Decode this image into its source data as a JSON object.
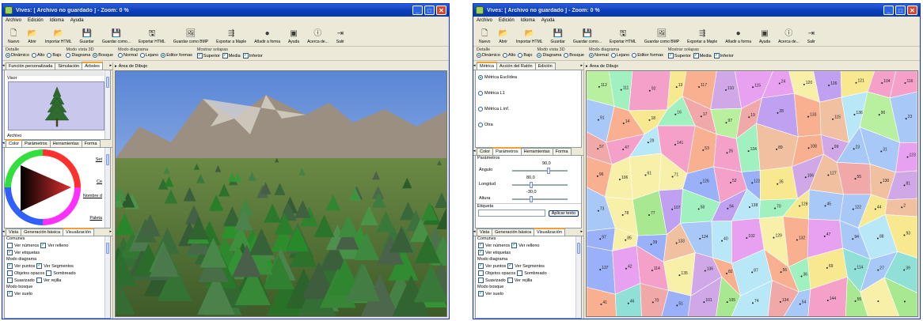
{
  "left": {
    "title": "Vives: [ Archivo no guardado ] - Zoom: 0 %",
    "menu": [
      "Archivo",
      "Edición",
      "Idioma",
      "Ayuda"
    ],
    "toolbar": [
      {
        "icon": "new-icon",
        "label": "Nuevo"
      },
      {
        "icon": "open-icon",
        "label": "Abrir"
      },
      {
        "icon": "import-icon",
        "label": "Importar HTML"
      },
      {
        "icon": "save-icon",
        "label": "Guardar"
      },
      {
        "icon": "save-as-icon",
        "label": "Guardar como..."
      },
      {
        "icon": "export-html-icon",
        "label": "Exportar HTML"
      },
      {
        "icon": "export-bmp-icon",
        "label": "Guardar como BMP"
      },
      {
        "icon": "export-maple-icon",
        "label": "Exportar a Maple"
      },
      {
        "icon": "add-shape-icon",
        "label": "Añadir a forma"
      },
      {
        "icon": "help-icon",
        "label": "Ayuda"
      },
      {
        "icon": "about-icon",
        "label": "Acerca de..."
      },
      {
        "icon": "exit-icon",
        "label": "Salir"
      }
    ],
    "options": {
      "detalle": {
        "title": "Detalle",
        "items": [
          "Dinámico",
          "Alto",
          "Bajo"
        ],
        "selected": 0
      },
      "modo3d": {
        "title": "Modo vista 3D",
        "items": [
          "Diagrama",
          "Bosque"
        ],
        "selected": 1
      },
      "modo_diagrama": {
        "title": "Modo diagrama",
        "items": [
          "Normal",
          "Lejano",
          "Editor formas"
        ],
        "selected": 2
      },
      "solapas": {
        "title": "Mostrar solapas",
        "items": [
          "Superior",
          "Media",
          "Inferior"
        ]
      }
    },
    "top_tabs": [
      "Función personalizada",
      "Simulación",
      "Árboles"
    ],
    "visor_label": "Visor",
    "archivo_label": "Archivo",
    "mid_tabs": [
      "Color",
      "Parámetros",
      "Herramientas",
      "Forma"
    ],
    "color_labels": [
      "Set",
      "Ce",
      "Nombre d",
      "Paleta"
    ],
    "bottom_tabs": [
      "Vista",
      "Generación básica",
      "Visualización"
    ],
    "vis": {
      "comunes": "Comunes",
      "ver_numeros": "Ver números",
      "ver_relleno": "Ver relleno",
      "ver_etiquetas": "Ver etiquetas",
      "modo_diagrama": "Modo diagrama",
      "ver_puntos": "Ver puntos",
      "ver_segmentos": "Ver Segmentos",
      "objetos_opacos": "Objetos opacos",
      "sombreado": "Sombreado",
      "suavizado": "Suavizado",
      "ver_rejilla": "Ver rejilla",
      "modo_bosque": "Modo bosque",
      "ver_suelo": "Ver suelo"
    },
    "canvas_label": "Área de Dibujo"
  },
  "right": {
    "title": "Vives: [ Archivo no guardado ] - Zoom: 0 %",
    "top_tabs": [
      "Métrica",
      "Acción del Ratón",
      "Edición"
    ],
    "metricas": [
      "Métrica Euclídea",
      "Métrica L1",
      "Métrica L inf.",
      "Otra"
    ],
    "metric_selected": 0,
    "mid_tabs": [
      "Color",
      "Parámetros",
      "Herramientas",
      "Forma"
    ],
    "params_title": "Parámetros",
    "angulo": {
      "label": "Ángulo",
      "value": "90,0"
    },
    "longitud": {
      "label": "Longitud",
      "value": "80,0"
    },
    "altura": {
      "label": "Altura",
      "value": "-30,0"
    },
    "etiqueta_label": "Etiqueta",
    "aplicar": "Aplicar texto",
    "bottom_tabs": [
      "Vista",
      "Generación básica",
      "Visualización"
    ],
    "canvas_label": "Área de Dibujo",
    "cell_numbers": [
      "112",
      "111",
      "92",
      "13",
      "117",
      "110",
      "115",
      "24",
      "120",
      "126",
      "121",
      "104",
      "116",
      "91",
      "14",
      "18",
      "16",
      "17",
      "97",
      "19",
      "28",
      "133",
      "115",
      "136",
      "90",
      "23",
      "57",
      "47",
      "29",
      "141",
      "53",
      "26",
      "134",
      "89",
      "108",
      "99",
      "23",
      "31",
      "123",
      "96",
      "106",
      "61",
      "71",
      "126",
      "52",
      "123",
      "35",
      "106",
      "127",
      "55",
      "130",
      "81",
      "73",
      "78",
      "77",
      "107",
      "58",
      "94",
      "138",
      "70",
      "128",
      "45",
      "122",
      "44",
      "2",
      "97",
      "85",
      "39",
      "133",
      "124",
      "40",
      "102",
      "129",
      "132",
      "47",
      "94",
      "88",
      "93",
      "137",
      "42",
      "114",
      "135",
      "136",
      "82",
      "87",
      "56",
      "36",
      "69",
      "114",
      "27",
      "39",
      "41",
      "46",
      "70",
      "51",
      "101",
      "105",
      "74",
      "134",
      "54",
      "144",
      "55"
    ]
  },
  "colors": {
    "accent": "#f0a035",
    "title_bar": "#0a3ab8",
    "window": "#ece9d8"
  }
}
